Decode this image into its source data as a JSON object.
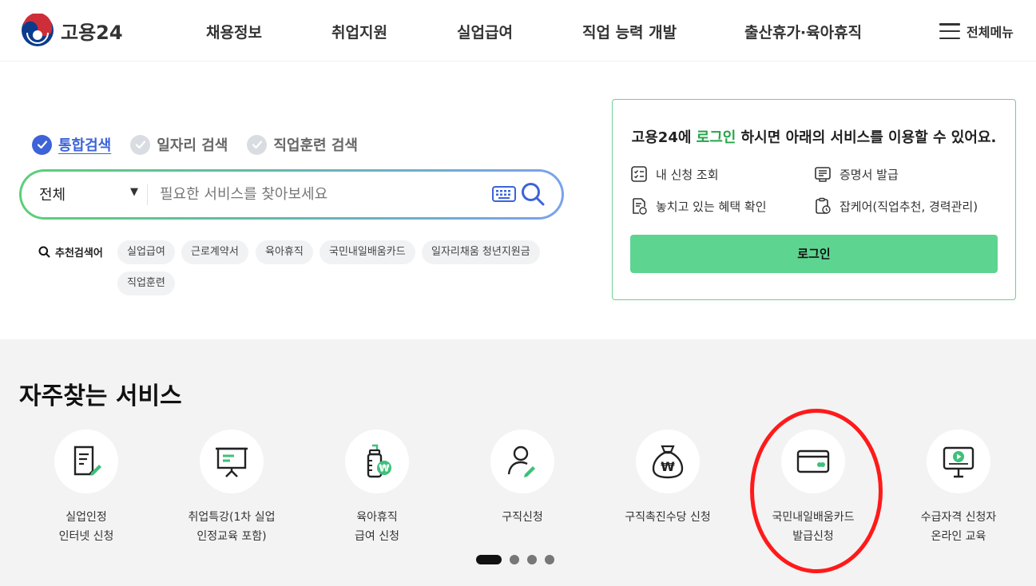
{
  "header": {
    "logo_text": "고용24",
    "nav": [
      "채용정보",
      "취업지원",
      "실업급여",
      "직업 능력 개발",
      "출산휴가·육아휴직"
    ],
    "menu_label": "전체메뉴"
  },
  "search": {
    "tabs": [
      {
        "label": "통합검색",
        "active": true
      },
      {
        "label": "일자리 검색",
        "active": false
      },
      {
        "label": "직업훈련 검색",
        "active": false
      }
    ],
    "scope": "전체",
    "placeholder": "필요한 서비스를 찾아보세요",
    "recommended_label": "추천검색어",
    "keywords": [
      "실업급여",
      "근로계약서",
      "육아휴직",
      "국민내일배움카드",
      "일자리채움 청년지원금",
      "직업훈련"
    ]
  },
  "login_panel": {
    "msg_prefix": "고용24에 ",
    "msg_highlight": "로그인",
    "msg_suffix": " 하시면 아래의 서비스를 이용할 수 있어요.",
    "services": [
      "내 신청 조회",
      "증명서 발급",
      "놓치고 있는 혜택 확인",
      "잡케어(직업추천, 경력관리)"
    ],
    "button": "로그인"
  },
  "frequent": {
    "title": "자주찾는 서비스",
    "items": [
      {
        "label": "실업인정\n인터넷 신청",
        "icon": "document-pen-icon"
      },
      {
        "label": "취업특강(1차 실업\n인정교육 포함)",
        "icon": "presentation-board-icon"
      },
      {
        "label": "육아휴직\n급여 신청",
        "icon": "baby-bottle-won-icon"
      },
      {
        "label": "구직신청",
        "icon": "person-pen-icon"
      },
      {
        "label": "구직촉진수당 신청",
        "icon": "money-bag-won-icon"
      },
      {
        "label": "국민내일배움카드\n발급신청",
        "icon": "card-icon"
      },
      {
        "label": "수급자격 신청자\n온라인 교육",
        "icon": "monitor-play-icon"
      }
    ],
    "pagination": {
      "total": 4,
      "current": 1
    }
  },
  "colors": {
    "accent_green": "#27a54a",
    "login_button": "#5ed491",
    "active_tab": "#3d63d8",
    "annotation": "#ff1a1a"
  }
}
